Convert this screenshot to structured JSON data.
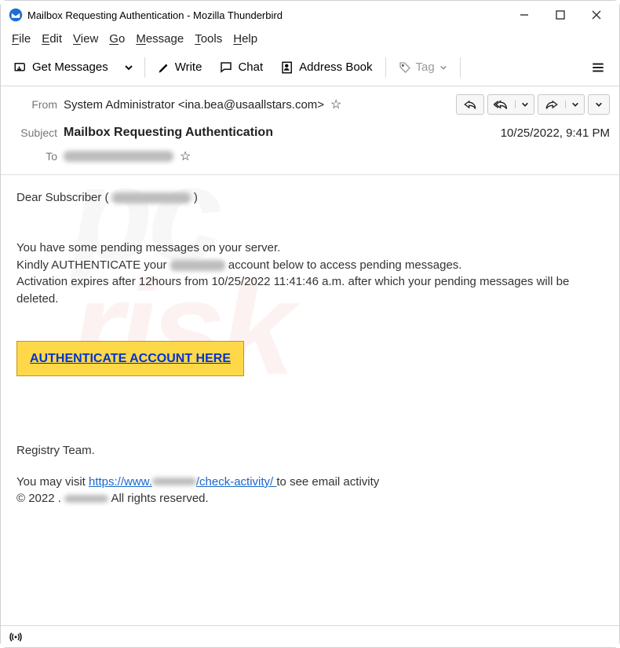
{
  "window": {
    "title": "Mailbox Requesting Authentication - Mozilla Thunderbird"
  },
  "menu": {
    "file": "File",
    "edit": "Edit",
    "view": "View",
    "go": "Go",
    "message": "Message",
    "tools": "Tools",
    "help": "Help"
  },
  "toolbar": {
    "get_messages": "Get Messages",
    "write": "Write",
    "chat": "Chat",
    "address_book": "Address Book",
    "tag": "Tag"
  },
  "header": {
    "from_label": "From",
    "from_value": "System Administrator <ina.bea@usaallstars.com>",
    "subject_label": "Subject",
    "subject_value": "Mailbox Requesting Authentication",
    "to_label": "To",
    "date": "10/25/2022, 9:41 PM"
  },
  "body": {
    "greeting_prefix": "Dear Subscriber ( ",
    "greeting_suffix": " )",
    "line1": "You have some pending messages on your server.",
    "line2_a": "Kindly AUTHENTICATE your ",
    "line2_b": " account below to access pending messages.",
    "line3": "Activation expires after 12hours from 10/25/2022 11:41:46 a.m. after which your pending messages will be deleted.",
    "cta": "AUTHENTICATE ACCOUNT HERE",
    "signoff": "Registry Team.",
    "foot_a": "You may visit ",
    "foot_link_a": "https://www.",
    "foot_link_b": "/check-activity/",
    "foot_b": " to see email activity",
    "copyright_a": "  © 2022 .",
    "copyright_b": " All rights reserved."
  }
}
